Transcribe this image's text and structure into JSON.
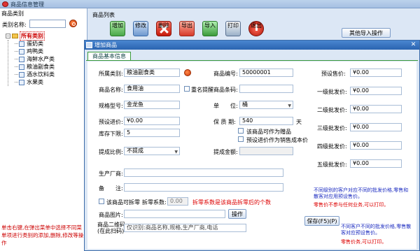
{
  "window": {
    "title": "商品信息管理"
  },
  "left_panel": {
    "header": "商品类别",
    "search_label": "类别名称:",
    "search_value": "",
    "tree_root": "所有类别",
    "tree_items": [
      "蛋奶类",
      "鸡鸭类",
      "海鲜水产类",
      "粮油副食类",
      "酒水饮料类",
      "水果类"
    ],
    "hint": "单击右键,在弹出菜单中选择不同菜单项进行类别的添加,删除,修改等操作"
  },
  "right_panel": {
    "header": "商品列表",
    "toolbar": [
      "增加",
      "修改",
      "删除",
      "导出",
      "导入",
      "打印",
      "退出"
    ],
    "other_import": "其他导入操作"
  },
  "dialog": {
    "title": "增加商品",
    "tab": "商品基本信息",
    "fields": {
      "category_label": "所属类别:",
      "category_value": "粮油副食类",
      "product_no_label": "商品编号:",
      "product_no_value": "50000001",
      "name_label": "商品名称:",
      "name_value": "食用油",
      "dup_check_label": "重名提醒",
      "barcode_label": "商品条码:",
      "barcode_value": "",
      "spec_label": "规格型号:",
      "spec_value": "金龙鱼",
      "unit_label": "单　　位:",
      "unit_value": "桶",
      "preset_buy_label": "预设进价:",
      "preset_buy_value": "¥0.00",
      "shelf_label": "保 质 期:",
      "shelf_value": "540",
      "shelf_unit": "天",
      "gift_label": "该商品可作为赠品",
      "cost_label": "预设进价作为销售成本价",
      "stock_min_label": "库存下限:",
      "stock_min_value": "5",
      "commission_label": "提成比例:",
      "commission_value": "不提成",
      "commission_amount_label": "提成金额:",
      "commission_amount_value": "",
      "manufacturer_label": "生产厂商:",
      "manufacturer_value": "",
      "remark_label": "备　　注:",
      "remark_value": "",
      "splittable_label": "该商品可拆零",
      "split_ratio_label": "拆零系数:",
      "split_ratio_value": "0.00",
      "split_note": "拆零系数是该商品拆零后的个数",
      "image_label": "商品图片:",
      "image_btn": "操作",
      "qr_label": "商品二维码:\n(在此扫码)",
      "qr_placeholder": "仅识别:商品名称,规格,生产厂商,电话",
      "save_btn": "保存(F5)(P)"
    },
    "prices": {
      "preset_sale_label": "预设售价:",
      "preset_sale_value": "¥0.00",
      "lvl1_label": "一级批发价:",
      "lvl1_value": "¥0.00",
      "lvl2_label": "二级批发价:",
      "lvl2_value": "¥0.00",
      "lvl3_label": "三级批发价:",
      "lvl3_value": "¥0.00",
      "lvl4_label": "四级批发价:",
      "lvl4_value": "¥0.00",
      "lvl5_label": "五级批发价:",
      "lvl5_value": "¥0.00",
      "note_blue_1": "不同级别的客户对应不同的批发价格,零售和散客对应用预设售价。",
      "note_red_1": "零售价不参与任何业务,可以打印。",
      "note_blue_2": "不同客户不同的批发价格,零售散客对应预设售价。",
      "note_red_2": "零售价务,可以打印。"
    }
  }
}
